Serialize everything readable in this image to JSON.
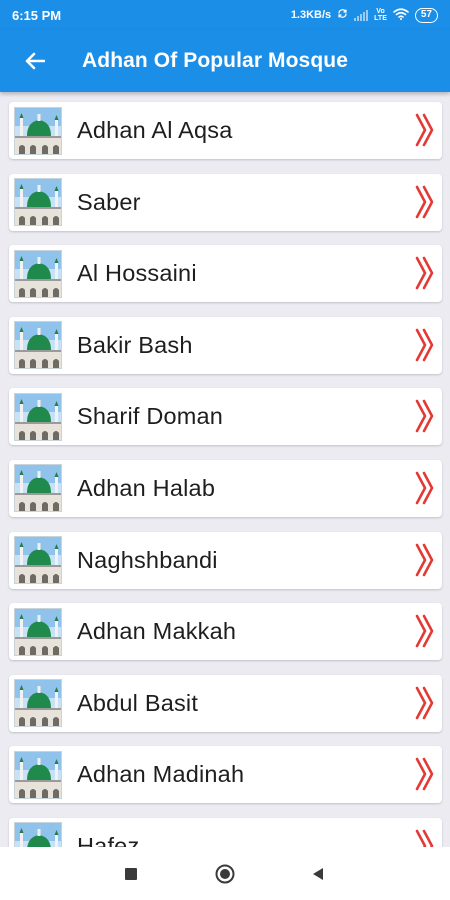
{
  "status": {
    "time": "6:15 PM",
    "speed": "1.3KB/s",
    "network_top": "Vo",
    "network_bottom": "LTE",
    "battery": "57"
  },
  "app_bar": {
    "title": "Adhan Of Popular Mosque",
    "back_icon": "arrow-left-icon"
  },
  "mosques": [
    {
      "label": "Adhan Al Aqsa"
    },
    {
      "label": "Saber"
    },
    {
      "label": "Al Hossaini"
    },
    {
      "label": "Bakir Bash"
    },
    {
      "label": "Sharif Doman"
    },
    {
      "label": "Adhan Halab"
    },
    {
      "label": "Naghshbandi"
    },
    {
      "label": "Adhan Makkah"
    },
    {
      "label": "Abdul Basit"
    },
    {
      "label": "Adhan Madinah"
    },
    {
      "label": "Hafez"
    }
  ],
  "colors": {
    "app_bar": "#1b8ee8",
    "chevron": "#e53935",
    "background": "#ecebf2"
  },
  "nav": {
    "recents_icon": "square-icon",
    "home_icon": "circle-icon",
    "back_icon": "triangle-back-icon"
  }
}
